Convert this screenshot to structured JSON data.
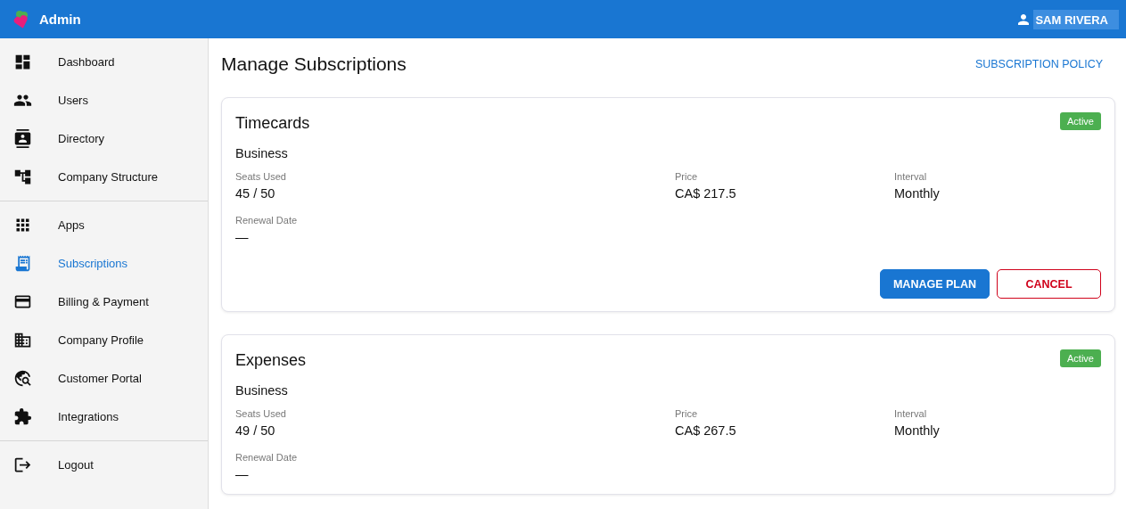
{
  "app_bar": {
    "title": "Admin",
    "user": "SAM RIVERA"
  },
  "sidebar": {
    "groups": [
      [
        {
          "label": "Dashboard",
          "selected": false
        },
        {
          "label": "Users",
          "selected": false
        },
        {
          "label": "Directory",
          "selected": false
        },
        {
          "label": "Company Structure",
          "selected": false
        }
      ],
      [
        {
          "label": "Apps",
          "selected": false
        },
        {
          "label": "Subscriptions",
          "selected": true
        },
        {
          "label": "Billing & Payment",
          "selected": false
        },
        {
          "label": "Company Profile",
          "selected": false
        },
        {
          "label": "Customer Portal",
          "selected": false
        },
        {
          "label": "Integrations",
          "selected": false
        }
      ],
      [
        {
          "label": "Logout",
          "selected": false
        }
      ]
    ]
  },
  "page": {
    "title": "Manage Subscriptions",
    "policy_link": "SUBSCRIPTION POLICY"
  },
  "subscriptions": [
    {
      "name": "Timecards",
      "status": "Active",
      "plan": "Business",
      "fields": [
        {
          "label": "Seats Used",
          "value": "45 / 50"
        },
        {
          "label": "Price",
          "value": "CA$ 217.5"
        },
        {
          "label": "Interval",
          "value": "Monthly"
        },
        {
          "label": "Renewal Date",
          "value": "—"
        }
      ],
      "actions": [
        {
          "kind": "primary",
          "label": "MANAGE PLAN"
        },
        {
          "kind": "danger",
          "label": "CANCEL"
        }
      ]
    },
    {
      "name": "Expenses",
      "status": "Active",
      "plan": "Business",
      "fields": [
        {
          "label": "Seats Used",
          "value": "49 / 50"
        },
        {
          "label": "Price",
          "value": "CA$ 267.5"
        },
        {
          "label": "Interval",
          "value": "Monthly"
        },
        {
          "label": "Renewal Date",
          "value": "—"
        }
      ]
    }
  ]
}
